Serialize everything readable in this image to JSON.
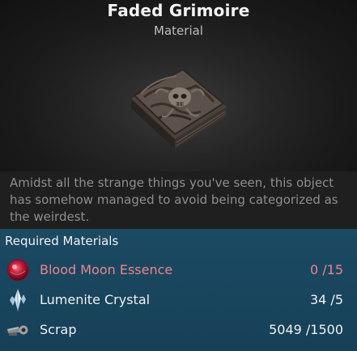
{
  "item": {
    "title": "Faded Grimoire",
    "category": "Material",
    "description": "Amidst all the strange things you've seen, this object has somehow managed to avoid being categorized as the weirdest."
  },
  "requirements": {
    "heading": "Required Materials",
    "materials": [
      {
        "name": "Blood Moon Essence",
        "count": "0 /15",
        "icon": "blood-moon-essence-icon",
        "status": "insufficient"
      },
      {
        "name": "Lumenite Crystal",
        "count": "34 /5",
        "icon": "lumenite-crystal-icon",
        "status": "sufficient"
      },
      {
        "name": "Scrap",
        "count": "5049 /1500",
        "icon": "scrap-icon",
        "status": "sufficient"
      }
    ]
  },
  "colors": {
    "insufficient": "#e8868a",
    "panel_blue": "#1c4a63",
    "text": "#f0f0f0"
  }
}
